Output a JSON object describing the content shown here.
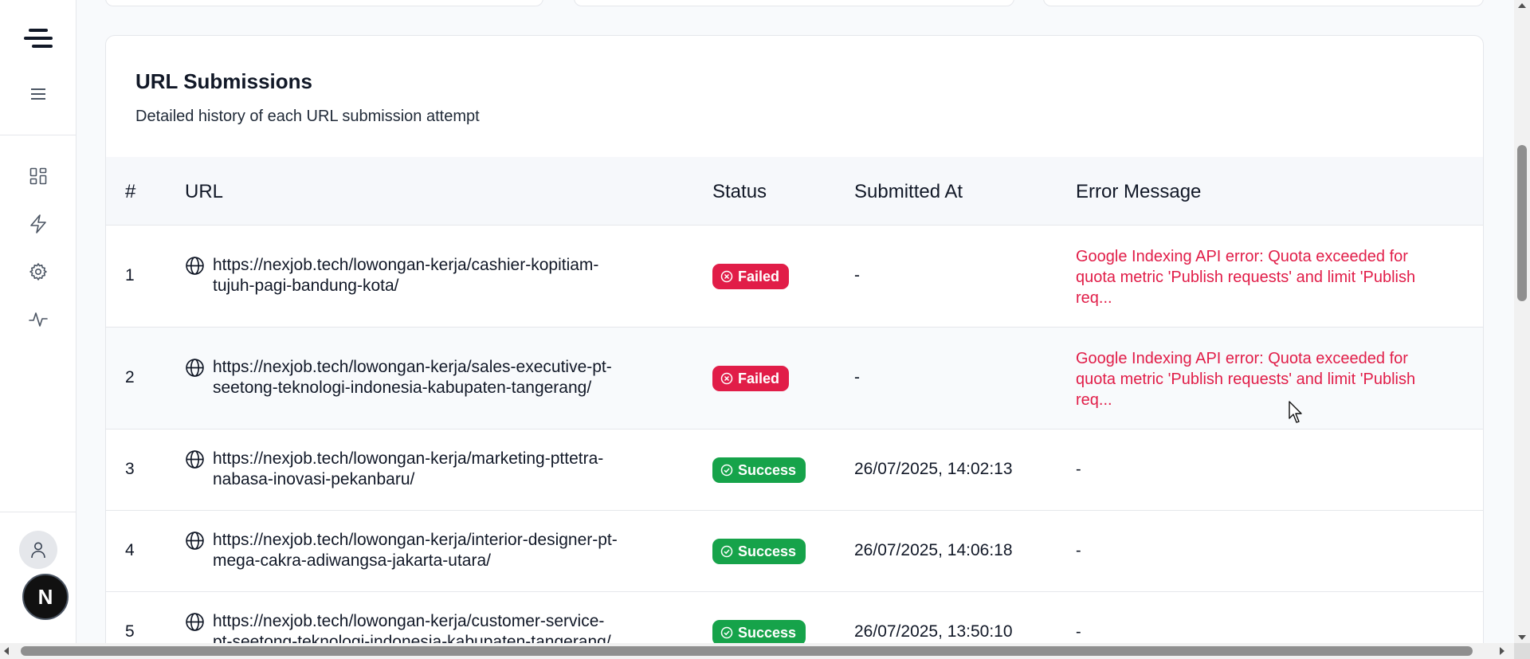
{
  "sidebar": {
    "items": [
      {
        "icon": "dashboard-icon"
      },
      {
        "icon": "lightning-icon"
      },
      {
        "icon": "gear-icon"
      },
      {
        "icon": "activity-icon"
      }
    ],
    "avatar_initial": "N"
  },
  "submissions": {
    "title": "URL Submissions",
    "subtitle": "Detailed history of each URL submission attempt",
    "columns": [
      "#",
      "URL",
      "Status",
      "Submitted At",
      "Error Message"
    ],
    "rows": [
      {
        "num": "1",
        "url_line1": "https://nexjob.tech/lowongan-kerja/cashier-kopitiam-",
        "url_line2": "tujuh-pagi-bandung-kota/",
        "status": "Failed",
        "submitted_at": "-",
        "error_line1": "Google Indexing API error: Quota exceeded for",
        "error_line2": "quota metric 'Publish requests' and limit 'Publish",
        "error_line3": "req..."
      },
      {
        "num": "2",
        "url_line1": "https://nexjob.tech/lowongan-kerja/sales-executive-pt-",
        "url_line2": "seetong-teknologi-indonesia-kabupaten-tangerang/",
        "status": "Failed",
        "submitted_at": "-",
        "error_line1": "Google Indexing API error: Quota exceeded for",
        "error_line2": "quota metric 'Publish requests' and limit 'Publish",
        "error_line3": "req..."
      },
      {
        "num": "3",
        "url_line1": "https://nexjob.tech/lowongan-kerja/marketing-pttetra-",
        "url_line2": "nabasa-inovasi-pekanbaru/",
        "status": "Success",
        "submitted_at": "26/07/2025, 14:02:13",
        "error": "-"
      },
      {
        "num": "4",
        "url_line1": "https://nexjob.tech/lowongan-kerja/interior-designer-pt-",
        "url_line2": "mega-cakra-adiwangsa-jakarta-utara/",
        "status": "Success",
        "submitted_at": "26/07/2025, 14:06:18",
        "error": "-"
      },
      {
        "num": "5",
        "url_line1": "https://nexjob.tech/lowongan-kerja/customer-service-",
        "url_line2": "pt-seetong-teknologi-indonesia-kabupaten-tangerang/",
        "status": "Success",
        "submitted_at": "26/07/2025, 13:50:10",
        "error": "-"
      }
    ]
  },
  "colors": {
    "failed": "#e11d48",
    "success": "#16a34a",
    "error_text": "#e11d48"
  }
}
